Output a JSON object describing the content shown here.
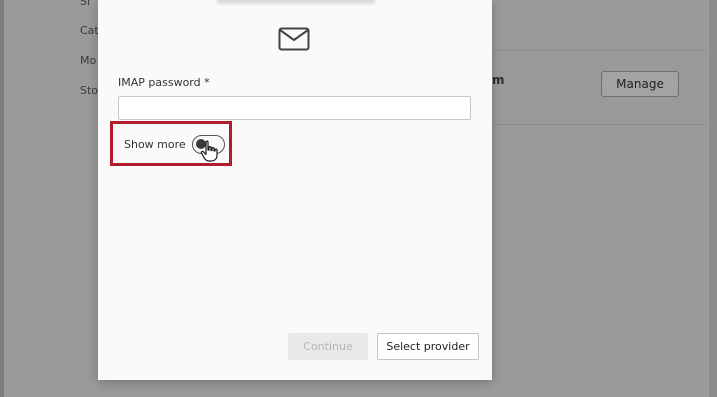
{
  "background": {
    "labels": [
      "Si",
      "Cat",
      "Mo",
      "Sto"
    ],
    "partial_heading": "m",
    "manage_label": "Manage"
  },
  "dialog": {
    "email_icon": "mail-icon",
    "password_label": "IMAP password *",
    "password_value": "",
    "show_more_label": "Show more",
    "show_more_on": false,
    "continue_label": "Continue",
    "select_provider_label": "Select provider"
  },
  "colors": {
    "highlight": "#b01c2e",
    "overlay": "#9a9a9a",
    "dialog_bg": "#fafafa"
  }
}
